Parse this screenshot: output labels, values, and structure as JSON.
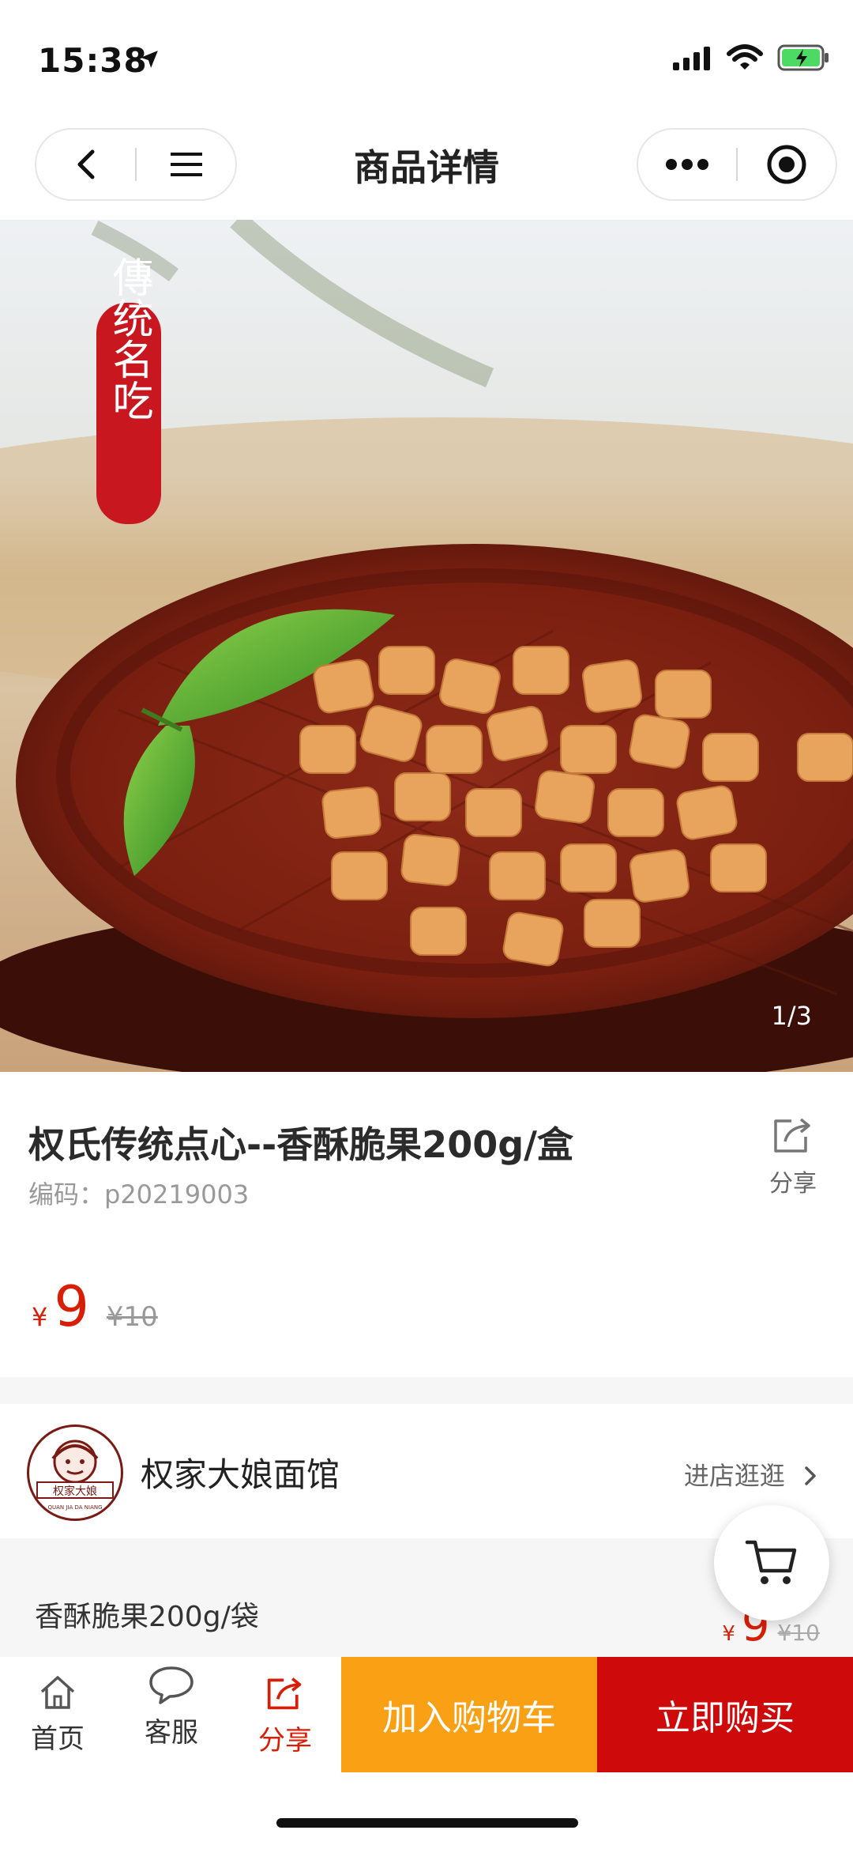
{
  "status_bar": {
    "time": "15:38"
  },
  "nav": {
    "title": "商品详情"
  },
  "hero": {
    "counter": "1/3",
    "badge_text": "傳统名吃"
  },
  "product": {
    "title": "权氏传统点心--香酥脆果200g/盒",
    "code": "编码：p20219003",
    "share_label": "分享",
    "currency": "¥",
    "price": "9",
    "original_price": "¥10"
  },
  "shop": {
    "name": "权家大娘面馆",
    "enter_label": "进店逛逛",
    "logo_text": "权家大娘",
    "logo_subtext": "QUAN JIA DA NIANG"
  },
  "spec": {
    "name": "香酥脆果200g/袋",
    "currency": "¥",
    "price": "9",
    "original_price": "¥10"
  },
  "bottom_bar": {
    "home_label": "首页",
    "service_label": "客服",
    "share_label": "分享",
    "add_to_cart_label": "加入购物车",
    "buy_now_label": "立即购买"
  },
  "colors": {
    "accent_red": "#d81e06",
    "cart_orange": "#f9a015",
    "buy_red": "#cf0a0a"
  },
  "icons": [
    "location-arrow-icon",
    "signal-icon",
    "wifi-icon",
    "battery-icon",
    "back-icon",
    "menu-icon",
    "more-icon",
    "target-icon",
    "share-icon",
    "chevron-right-icon",
    "cart-icon",
    "home-icon",
    "chat-icon"
  ]
}
